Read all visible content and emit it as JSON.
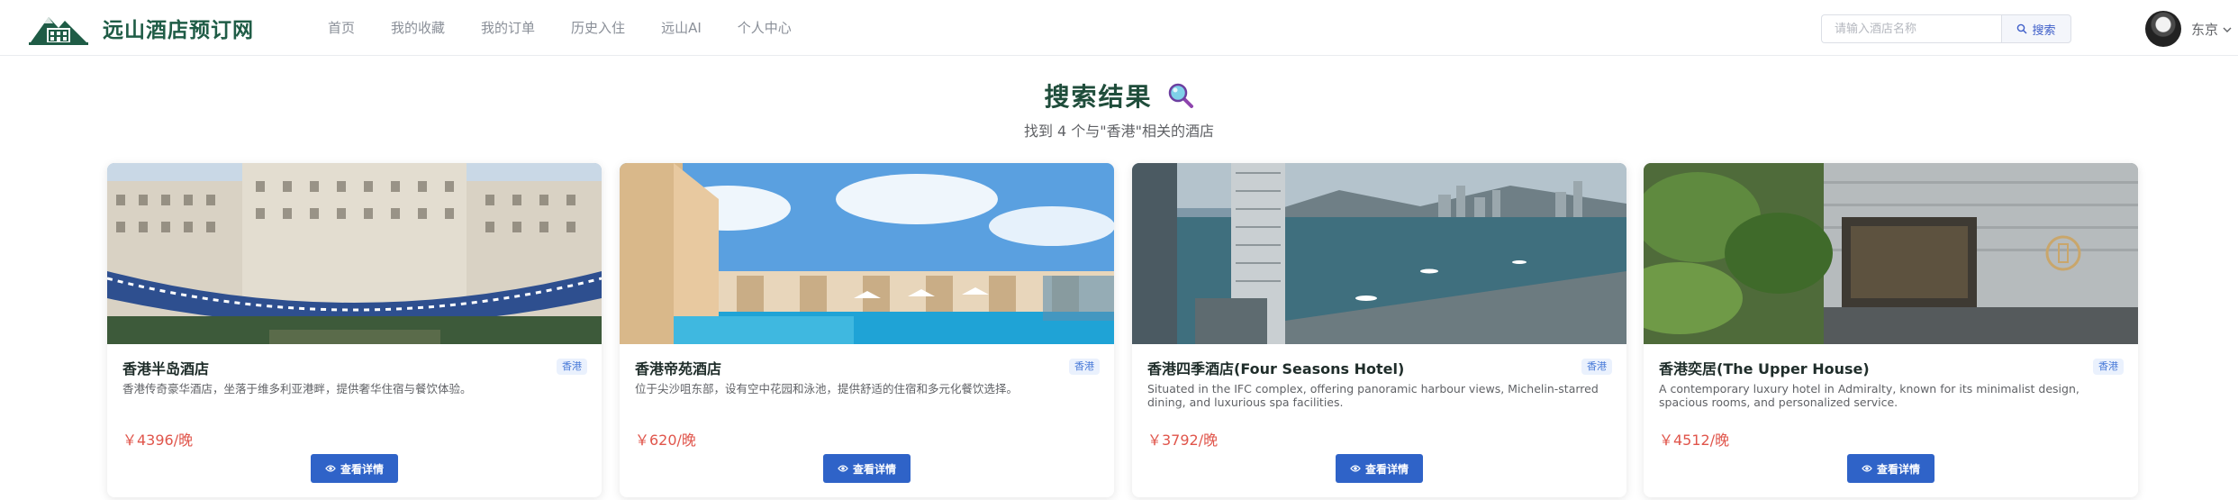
{
  "header": {
    "brand": "远山酒店预订网",
    "nav": [
      "首页",
      "我的收藏",
      "我的订单",
      "历史入住",
      "远山AI",
      "个人中心"
    ],
    "search_placeholder": "请输入酒店名称",
    "search_button": "搜索",
    "user_name": "东京"
  },
  "results": {
    "title": "搜索结果",
    "subtitle": "找到 4 个与\"香港\"相关的酒店"
  },
  "hotels": [
    {
      "name": "香港半岛酒店",
      "tag": "香港",
      "description": "香港传奇豪华酒店，坐落于维多利亚港畔，提供奢华住宿与餐饮体验。",
      "price": "￥4396/晚",
      "button": "查看详情"
    },
    {
      "name": "香港帝苑酒店",
      "tag": "香港",
      "description": "位于尖沙咀东部，设有空中花园和泳池，提供舒适的住宿和多元化餐饮选择。",
      "price": "￥620/晚",
      "button": "查看详情"
    },
    {
      "name": "香港四季酒店(Four Seasons Hotel)",
      "tag": "香港",
      "description": "Situated in the IFC complex, offering panoramic harbour views, Michelin-starred dining, and luxurious spa facilities.",
      "price": "￥3792/晚",
      "button": "查看详情"
    },
    {
      "name": "香港奕居(The Upper House)",
      "tag": "香港",
      "description": "A contemporary luxury hotel in Admiralty, known for its minimalist design, spacious rooms, and personalized service.",
      "price": "￥4512/晚",
      "button": "查看详情"
    }
  ],
  "colors": {
    "brand": "#1f5c46",
    "primary_button": "#2f63c8",
    "price": "#e0554b",
    "tag_bg": "#eaf1fd"
  }
}
